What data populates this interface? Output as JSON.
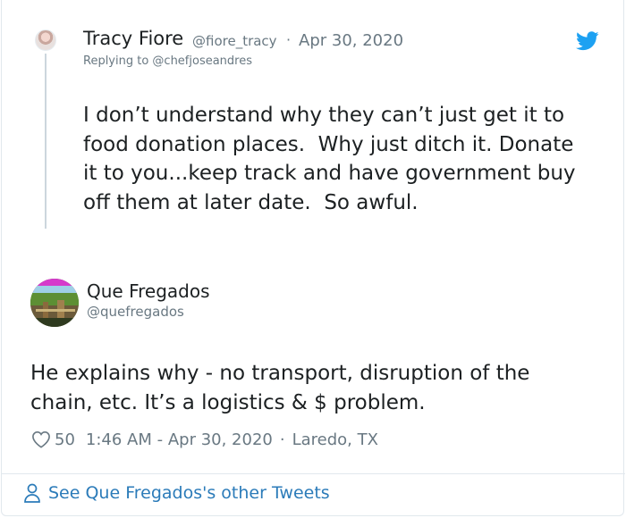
{
  "parent_tweet": {
    "name": "Tracy Fiore",
    "handle": "@fiore_tracy",
    "separator": "·",
    "date": "Apr 30, 2020",
    "replying_to": "Replying to @chefjoseandres",
    "text_lines": [
      "I don’t understand why they can’t just get it to",
      "food donation places.  Why just ditch it. Donate",
      "it to you...keep track and have government buy",
      "off them at later date.  So awful."
    ]
  },
  "main_tweet": {
    "name": "Que Fregados",
    "handle": "@quefregados",
    "text_lines": [
      "He explains why - no transport, disruption of the",
      "chain, etc. It’s a logistics & $ problem."
    ],
    "likes": "50",
    "timestamp": "1:46 AM - Apr 30, 2020",
    "separator": "·",
    "location": "Laredo, TX"
  },
  "footer": {
    "link_text": "See Que Fregados's other Tweets"
  },
  "colors": {
    "link": "#2b7bb9",
    "secondary_text": "#697882",
    "primary_text": "#1c2022",
    "twitter_blue": "#1da1f2",
    "border": "#e1e8ed"
  },
  "icons": {
    "brand": "twitter-bird-icon",
    "like": "heart-icon",
    "profile": "person-icon"
  }
}
